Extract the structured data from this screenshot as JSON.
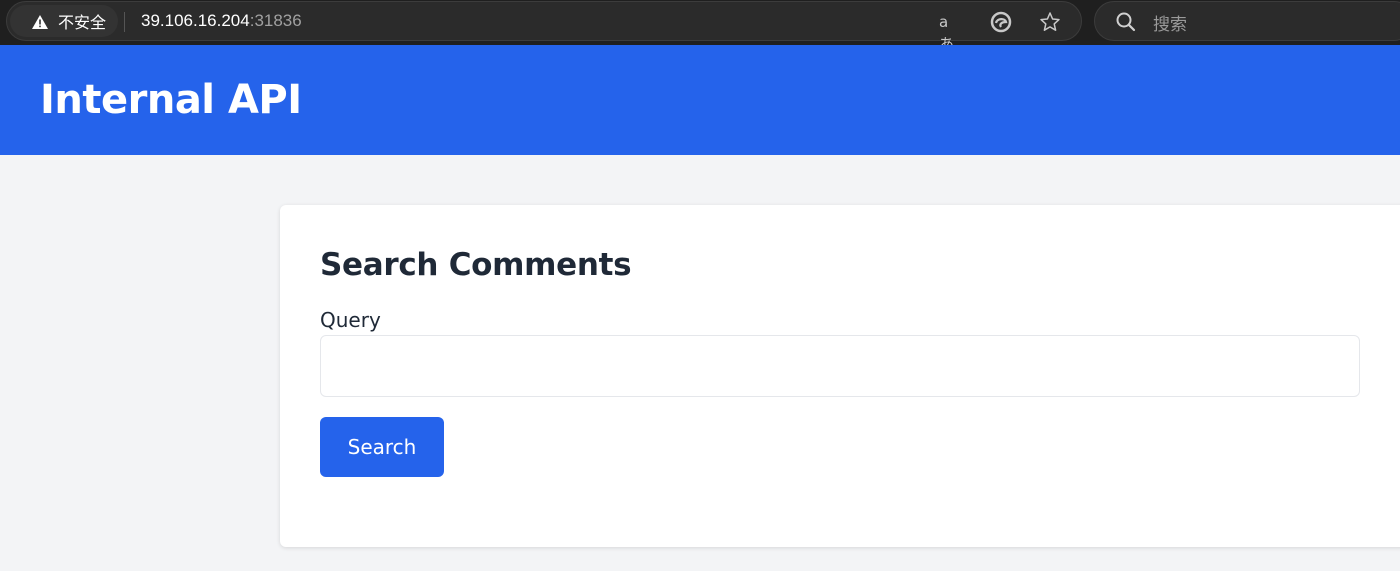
{
  "browser": {
    "security_label": "不安全",
    "url_host": "39.106.16.204",
    "url_port": ":31836",
    "translate_glyph": "aあ",
    "search_placeholder": "搜索"
  },
  "header": {
    "title": "Internal API"
  },
  "card": {
    "title": "Search Comments",
    "query_label": "Query",
    "query_value": "",
    "search_button": "Search"
  },
  "colors": {
    "brand": "#2563eb",
    "page_bg": "#f3f4f6",
    "text_dark": "#1f2937"
  }
}
